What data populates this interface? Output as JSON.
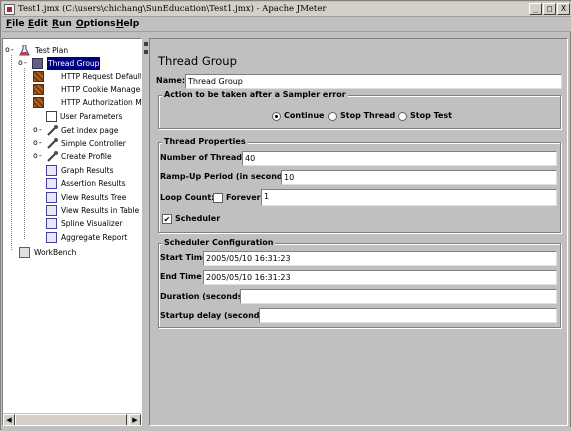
{
  "window": {
    "title": "Test1.jmx (C:\\users\\chichang\\SunEducation\\Test1.jmx) - Apache JMeter",
    "minimize_glyph": "_",
    "maximize_glyph": "□",
    "close_glyph": "X"
  },
  "menu": {
    "items": [
      {
        "label": "File",
        "mnemonic": "F",
        "rest": "ile"
      },
      {
        "label": "Edit",
        "mnemonic": "E",
        "rest": "dit"
      },
      {
        "label": "Run",
        "mnemonic": "R",
        "rest": "un"
      },
      {
        "label": "Options",
        "mnemonic": "O",
        "rest": "ptions"
      },
      {
        "label": "Help",
        "mnemonic": "H",
        "rest": "elp"
      }
    ]
  },
  "tree": {
    "nodes": [
      {
        "label": "Test Plan",
        "icon": "flask-icon"
      },
      {
        "label": "Thread Group",
        "icon": "thread-group-icon",
        "selected": true
      },
      {
        "label": "HTTP Request Defaults",
        "icon": "config-element-icon"
      },
      {
        "label": "HTTP Cookie Manager",
        "icon": "config-element-icon"
      },
      {
        "label": "HTTP Authorization Manager",
        "icon": "config-element-icon"
      },
      {
        "label": "User Parameters",
        "icon": "document-icon"
      },
      {
        "label": "Get index page",
        "icon": "pipette-icon"
      },
      {
        "label": "Simple Controller",
        "icon": "pipette-icon"
      },
      {
        "label": "Create Profile",
        "icon": "pipette-icon"
      },
      {
        "label": "Graph Results",
        "icon": "listener-icon"
      },
      {
        "label": "Assertion Results",
        "icon": "listener-icon"
      },
      {
        "label": "View Results Tree",
        "icon": "listener-icon"
      },
      {
        "label": "View Results in Table",
        "icon": "listener-icon"
      },
      {
        "label": "Spline Visualizer",
        "icon": "listener-icon"
      },
      {
        "label": "Aggregate Report",
        "icon": "listener-icon"
      },
      {
        "label": "WorkBench",
        "icon": "workbench-icon"
      }
    ],
    "expand_glyph": "-",
    "collapsed_glyph": "o-",
    "scroll_left_glyph": "◀",
    "scroll_right_glyph": "▶"
  },
  "panel": {
    "title": "Thread Group",
    "name_label": "Name:",
    "name_value": "Thread Group",
    "error_action": {
      "title": "Action to be taken after a Sampler error",
      "options": [
        {
          "label": "Continue",
          "selected": true
        },
        {
          "label": "Stop Thread",
          "selected": false
        },
        {
          "label": "Stop Test",
          "selected": false
        }
      ]
    },
    "thread_props": {
      "title": "Thread Properties",
      "threads_label": "Number of Threads:",
      "threads_value": "40",
      "rampup_label": "Ramp-Up Period (in seconds):",
      "rampup_value": "10",
      "loop_label": "Loop Count:",
      "forever_label": "Forever",
      "forever_checked": false,
      "loop_value": "1",
      "scheduler_label": "Scheduler",
      "scheduler_checked": true,
      "check_glyph": "✔"
    },
    "scheduler": {
      "title": "Scheduler Configuration",
      "start_label": "Start Time",
      "start_value": "2005/05/10 16:31:23",
      "end_label": "End Time",
      "end_value": "2005/05/10 16:31:23",
      "duration_label": "Duration (seconds)",
      "duration_value": "",
      "delay_label": "Startup delay (seconds)",
      "delay_value": ""
    }
  }
}
